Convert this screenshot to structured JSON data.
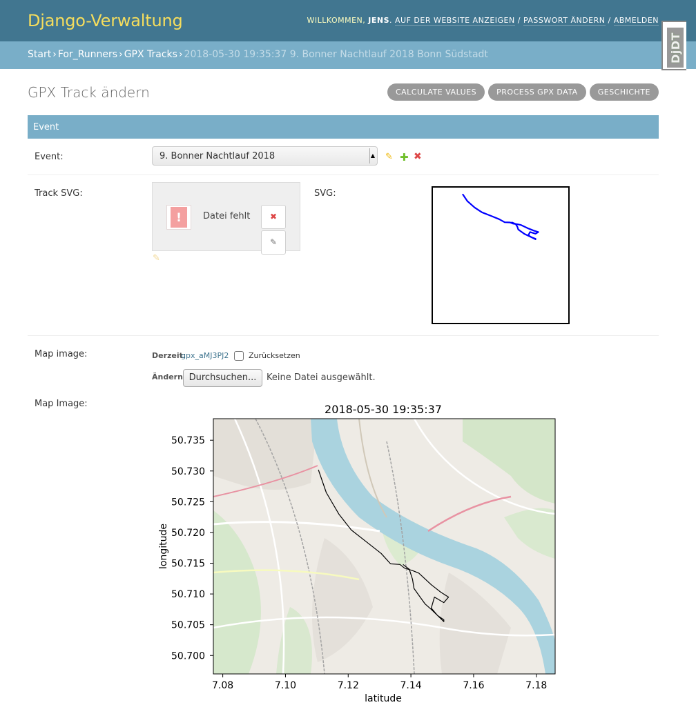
{
  "header": {
    "brand": "Django-Verwaltung",
    "welcome": "Willkommen,",
    "username": "jens",
    "links": [
      "Auf der Website anzeigen",
      "Passwort ändern",
      "Abmelden"
    ]
  },
  "breadcrumbs": {
    "items": [
      "Start",
      "For_Runners",
      "GPX Tracks"
    ],
    "current": "2018-05-30 19:35:37 9. Bonner Nachtlauf 2018 Bonn Südstadt"
  },
  "debug_toolbar": {
    "label": "DjDT"
  },
  "page": {
    "title": "GPX Track ändern",
    "tools": [
      "Calculate Values",
      "Process GPX Data",
      "Geschichte"
    ]
  },
  "fieldset": {
    "title": "Event"
  },
  "fields": {
    "event": {
      "label": "Event:",
      "value": "9. Bonner Nachtlauf 2018"
    },
    "track_svg": {
      "label": "Track SVG:",
      "missing_text": "Datei fehlt"
    },
    "svg": {
      "label": "SVG:"
    },
    "map_image_upload": {
      "label": "Map image:",
      "current_label": "Derzeit:",
      "current_value": "gpx_aMJ3PJ2",
      "reset_label": "Zurücksetzen",
      "change_label": "Ändern:",
      "browse_label": "Durchsuchen...",
      "no_file": "Keine Datei ausgewählt."
    },
    "map_image": {
      "label": "Map Image:"
    }
  },
  "chart_data": {
    "type": "line",
    "title": "2018-05-30 19:35:37",
    "xlabel": "latitude",
    "ylabel": "longitude",
    "xlim": [
      7.077,
      7.186
    ],
    "ylim": [
      50.697,
      50.7385
    ],
    "x_ticks": [
      "7.08",
      "7.10",
      "7.12",
      "7.14",
      "7.16",
      "7.18"
    ],
    "y_ticks": [
      "50.700",
      "50.705",
      "50.710",
      "50.715",
      "50.720",
      "50.725",
      "50.730",
      "50.735"
    ],
    "background": "map tiles",
    "grid": false,
    "series": [
      {
        "color": "#000000",
        "x": [
          7.1105,
          7.113,
          7.117,
          7.121,
          7.126,
          7.1305,
          7.1335,
          7.1365,
          7.138,
          7.1405,
          7.1425,
          7.1465,
          7.1495,
          7.152,
          7.1505,
          7.1475,
          7.1465,
          7.1485,
          7.1505,
          7.1505,
          7.1485,
          7.1465,
          7.1445,
          7.1425,
          7.141,
          7.1405,
          7.1395,
          7.1375
        ],
        "y": [
          50.7302,
          50.7265,
          50.723,
          50.7204,
          50.7184,
          50.7166,
          50.7149,
          50.7148,
          50.7142,
          50.7138,
          50.7134,
          50.7115,
          50.7103,
          50.7095,
          50.7086,
          50.7095,
          50.7077,
          50.7065,
          50.7055,
          50.7058,
          50.7065,
          50.7075,
          50.7084,
          50.7098,
          50.7109,
          50.7124,
          50.714,
          50.7148
        ]
      }
    ]
  },
  "svg_preview": {
    "color": "#0000ff",
    "x": [
      7.1105,
      7.113,
      7.117,
      7.121,
      7.126,
      7.1305,
      7.1335,
      7.1365,
      7.138,
      7.1405,
      7.1425,
      7.1465,
      7.1495,
      7.152,
      7.1505,
      7.1475,
      7.1465,
      7.1485,
      7.1505,
      7.1505,
      7.1485,
      7.1465,
      7.1445,
      7.1425,
      7.141,
      7.1405,
      7.1395,
      7.1375
    ],
    "y": [
      50.7302,
      50.7265,
      50.723,
      50.7204,
      50.7184,
      50.7166,
      50.7149,
      50.7148,
      50.7142,
      50.7138,
      50.7134,
      50.7115,
      50.7103,
      50.7095,
      50.7086,
      50.7095,
      50.7077,
      50.7065,
      50.7055,
      50.7058,
      50.7065,
      50.7075,
      50.7084,
      50.7098,
      50.7109,
      50.7124,
      50.714,
      50.7148
    ]
  },
  "colors": {
    "header_bg": "#417690",
    "brand": "#f5dd5d",
    "breadcrumb_bg": "#79aec8",
    "tool_button": "#999999",
    "change_icon": "#efb80b",
    "add_icon": "#70bf2b",
    "delete_icon": "#dd4646",
    "link": "#417690"
  },
  "icons": {
    "change": "pencil-icon",
    "add": "plus-icon",
    "delete": "x-icon",
    "file_missing": "file-error-icon",
    "clear": "x-icon",
    "edit": "pencil-icon"
  }
}
